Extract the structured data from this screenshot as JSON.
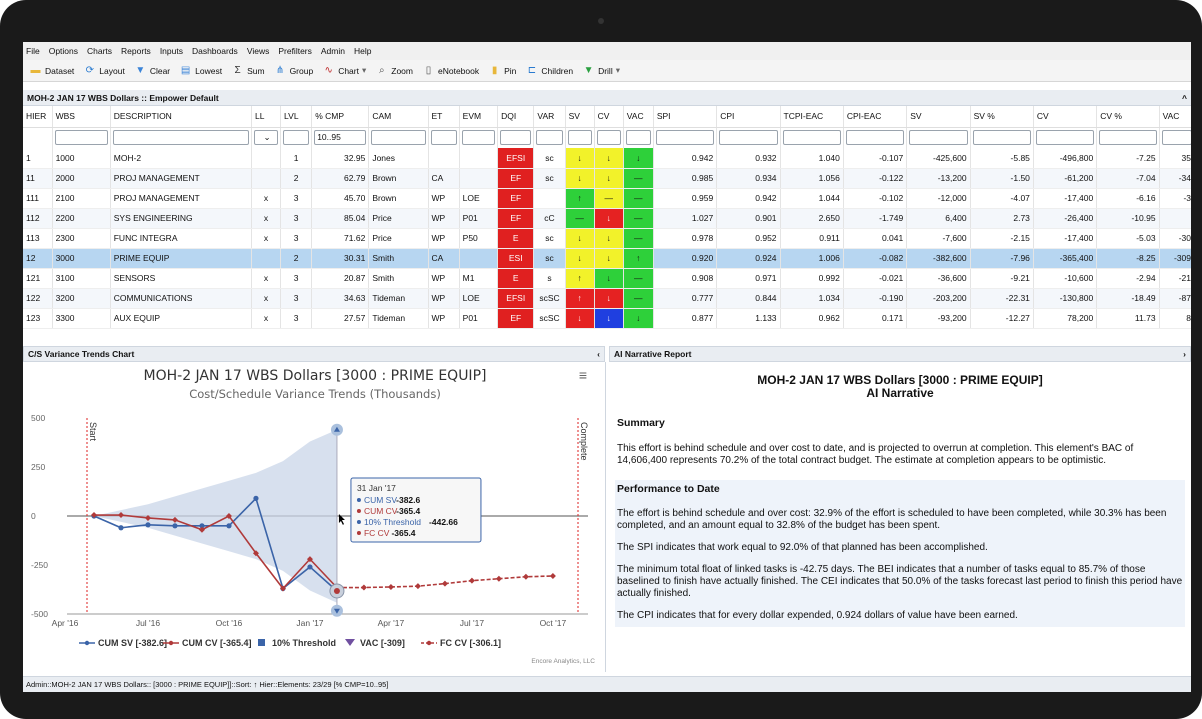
{
  "menu": [
    "File",
    "Options",
    "Charts",
    "Reports",
    "Inputs",
    "Dashboards",
    "Views",
    "Prefilters",
    "Admin",
    "Help"
  ],
  "toolbar": [
    {
      "label": "Dataset",
      "icon": "folder-icon",
      "glyph": "▬",
      "color": "#e8b73a"
    },
    {
      "label": "Layout",
      "icon": "refresh-icon",
      "glyph": "⟳",
      "color": "#2a7bd0"
    },
    {
      "label": "Clear",
      "icon": "clear-filter-icon",
      "glyph": "▼",
      "color": "#3b84d8"
    },
    {
      "label": "Lowest",
      "icon": "lowest-icon",
      "glyph": "▤",
      "color": "#3b84d8"
    },
    {
      "label": "Sum",
      "icon": "sigma-icon",
      "glyph": "Σ",
      "color": "#333333"
    },
    {
      "label": "Group",
      "icon": "group-icon",
      "glyph": "⋔",
      "color": "#2a7bd0"
    },
    {
      "label": "Chart",
      "icon": "chart-icon",
      "glyph": "∿",
      "color": "#c03030",
      "dropdown": "▾"
    },
    {
      "label": "Zoom",
      "icon": "zoom-icon",
      "glyph": "⌕",
      "color": "#555555"
    },
    {
      "label": "eNotebook",
      "icon": "notebook-icon",
      "glyph": "▯",
      "color": "#555555"
    },
    {
      "label": "Pin",
      "icon": "pin-icon",
      "glyph": "▮",
      "color": "#e8b73a"
    },
    {
      "label": "Children",
      "icon": "children-icon",
      "glyph": "⊏",
      "color": "#2a7bd0"
    },
    {
      "label": "Drill",
      "icon": "drill-icon",
      "glyph": "▼",
      "color": "#2aa040",
      "dropdown": "▾"
    }
  ],
  "grid": {
    "title": "MOH-2 JAN 17 WBS Dollars :: Empower Default",
    "collapse": "^",
    "columns": [
      "HIER",
      "WBS",
      "DESCRIPTION",
      "LL",
      "LVL",
      "% CMP",
      "CAM",
      "ET",
      "EVM",
      "DQI",
      "VAR",
      "SV",
      "CV",
      "VAC",
      "SPI",
      "CPI",
      "TCPI-EAC",
      "CPI-EAC",
      "SV",
      "SV %",
      "CV",
      "CV %",
      "VAC"
    ],
    "filter_cmp": "10..95",
    "ll_dropdown": "⌄",
    "rows": [
      {
        "hier": "1",
        "wbs": "1000",
        "desc": "MOH-2",
        "ll": "",
        "lvl": "1",
        "cmp": "32.95",
        "cam": "Jones",
        "et": "",
        "evm": "",
        "dqi": "EFSI",
        "var": "sc",
        "sv": "↓",
        "svc": "cy",
        "cv": "↓",
        "cvc": "cy",
        "vac": "↓",
        "vacc": "cg",
        "spi": "0.942",
        "cpi": "0.932",
        "tcpi": "1.040",
        "cpieac": "-0.107",
        "svd": "-425,600",
        "svp": "-5.85",
        "cvd": "-496,800",
        "cvp": "-7.25",
        "vacd": "35"
      },
      {
        "hier": "11",
        "wbs": "2000",
        "desc": "PROJ MANAGEMENT",
        "ll": "",
        "lvl": "2",
        "cmp": "62.79",
        "cam": "Brown",
        "et": "CA",
        "evm": "",
        "dqi": "EF",
        "var": "sc",
        "sv": "↓",
        "svc": "cy",
        "cv": "↓",
        "cvc": "cy",
        "vac": "—",
        "vacc": "cg",
        "spi": "0.985",
        "cpi": "0.934",
        "tcpi": "1.056",
        "cpieac": "-0.122",
        "svd": "-13,200",
        "svp": "-1.50",
        "cvd": "-61,200",
        "cvp": "-7.04",
        "vacd": "-34"
      },
      {
        "hier": "111",
        "wbs": "2100",
        "desc": "PROJ MANAGEMENT",
        "ll": "x",
        "lvl": "3",
        "cmp": "45.70",
        "cam": "Brown",
        "et": "WP",
        "evm": "LOE",
        "dqi": "EF",
        "var": "",
        "sv": "↑",
        "svc": "cg",
        "cv": "—",
        "cvc": "cy",
        "vac": "—",
        "vacc": "cg",
        "spi": "0.959",
        "cpi": "0.942",
        "tcpi": "1.044",
        "cpieac": "-0.102",
        "svd": "-12,000",
        "svp": "-4.07",
        "cvd": "-17,400",
        "cvp": "-6.16",
        "vacd": "-3"
      },
      {
        "hier": "112",
        "wbs": "2200",
        "desc": "SYS ENGINEERING",
        "ll": "x",
        "lvl": "3",
        "cmp": "85.04",
        "cam": "Price",
        "et": "WP",
        "evm": "P01",
        "dqi": "EF",
        "var": "cC",
        "sv": "—",
        "svc": "cg",
        "cv": "↓",
        "cvc": "cr",
        "vac": "—",
        "vacc": "cg",
        "spi": "1.027",
        "cpi": "0.901",
        "tcpi": "2.650",
        "cpieac": "-1.749",
        "svd": "6,400",
        "svp": "2.73",
        "cvd": "-26,400",
        "cvp": "-10.95",
        "vacd": ""
      },
      {
        "hier": "113",
        "wbs": "2300",
        "desc": "FUNC INTEGRA",
        "ll": "x",
        "lvl": "3",
        "cmp": "71.62",
        "cam": "Price",
        "et": "WP",
        "evm": "P50",
        "dqi": "E",
        "var": "sc",
        "sv": "↓",
        "svc": "cy",
        "cv": "↓",
        "cvc": "cy",
        "vac": "—",
        "vacc": "cg",
        "spi": "0.978",
        "cpi": "0.952",
        "tcpi": "0.911",
        "cpieac": "0.041",
        "svd": "-7,600",
        "svp": "-2.15",
        "cvd": "-17,400",
        "cvp": "-5.03",
        "vacd": "-30"
      },
      {
        "hier": "12",
        "wbs": "3000",
        "desc": "PRIME EQUIP",
        "ll": "",
        "lvl": "2",
        "cmp": "30.31",
        "cam": "Smith",
        "et": "CA",
        "evm": "",
        "dqi": "ESI",
        "var": "sc",
        "sv": "↓",
        "svc": "cy",
        "cv": "↓",
        "cvc": "cy",
        "vac": "↑",
        "vacc": "cg",
        "spi": "0.920",
        "cpi": "0.924",
        "tcpi": "1.006",
        "cpieac": "-0.082",
        "svd": "-382,600",
        "svp": "-7.96",
        "cvd": "-365,400",
        "cvp": "-8.25",
        "vacd": "-309",
        "sel": true
      },
      {
        "hier": "121",
        "wbs": "3100",
        "desc": "SENSORS",
        "ll": "x",
        "lvl": "3",
        "cmp": "20.87",
        "cam": "Smith",
        "et": "WP",
        "evm": "M1",
        "dqi": "E",
        "var": "s",
        "sv": "↑",
        "svc": "cy",
        "cv": "↓",
        "cvc": "cg",
        "vac": "—",
        "vacc": "cg",
        "spi": "0.908",
        "cpi": "0.971",
        "tcpi": "0.992",
        "cpieac": "-0.021",
        "svd": "-36,600",
        "svp": "-9.21",
        "cvd": "-10,600",
        "cvp": "-2.94",
        "vacd": "-21"
      },
      {
        "hier": "122",
        "wbs": "3200",
        "desc": "COMMUNICATIONS",
        "ll": "x",
        "lvl": "3",
        "cmp": "34.63",
        "cam": "Tideman",
        "et": "WP",
        "evm": "LOE",
        "dqi": "EFSI",
        "var": "scSC",
        "sv": "↑",
        "svc": "cr",
        "cv": "↓",
        "cvc": "cr",
        "vac": "—",
        "vacc": "cg",
        "spi": "0.777",
        "cpi": "0.844",
        "tcpi": "1.034",
        "cpieac": "-0.190",
        "svd": "-203,200",
        "svp": "-22.31",
        "cvd": "-130,800",
        "cvp": "-18.49",
        "vacd": "-87"
      },
      {
        "hier": "123",
        "wbs": "3300",
        "desc": "AUX EQUIP",
        "ll": "x",
        "lvl": "3",
        "cmp": "27.57",
        "cam": "Tideman",
        "et": "WP",
        "evm": "P01",
        "dqi": "EF",
        "var": "scSC",
        "sv": "↓",
        "svc": "cr",
        "cv": "↓",
        "cvc": "cb",
        "vac": "↓",
        "vacc": "cg",
        "spi": "0.877",
        "cpi": "1.133",
        "tcpi": "0.962",
        "cpieac": "0.171",
        "svd": "-93,200",
        "svp": "-12.27",
        "cvd": "78,200",
        "cvp": "11.73",
        "vacd": "8"
      }
    ]
  },
  "chart_panel": {
    "title": "C/S Variance Trends Chart",
    "collapse": "‹",
    "menu_icon": "≡"
  },
  "narr_panel": {
    "title": "AI Narrative Report",
    "expand": "›"
  },
  "chart_data": {
    "type": "line",
    "title": "MOH-2 JAN 17 WBS Dollars [3000 : PRIME EQUIP]",
    "subtitle": "Cost/Schedule Variance Trends (Thousands)",
    "x": [
      "May '16",
      "Jun '16",
      "Jul '16",
      "Aug '16",
      "Sep '16",
      "Oct '16",
      "Nov '16",
      "Dec '16",
      "Jan '17",
      "Feb '17",
      "Mar '17",
      "Apr '17",
      "May '17",
      "Jun '17",
      "Jul '17",
      "Aug '17",
      "Sep '17",
      "Oct '17"
    ],
    "xticks": [
      "Apr '16",
      "Jul '16",
      "Oct '16",
      "Jan '17",
      "Apr '17",
      "Jul '17",
      "Oct '17"
    ],
    "yticks": [
      500,
      250,
      0,
      -250,
      -500
    ],
    "ylim": [
      -500,
      500
    ],
    "series": [
      {
        "name": "CUM SV [-382.6]",
        "color": "#3b64a8",
        "values": [
          0,
          -60,
          -45,
          -50,
          -50,
          -50,
          90,
          -370,
          -260,
          -382.6
        ]
      },
      {
        "name": "CUM CV [-365.4]",
        "color": "#b03a3a",
        "values": [
          5,
          5,
          -10,
          -20,
          -70,
          0,
          -190,
          -370,
          -220,
          -365.4
        ]
      },
      {
        "name": "FC CV [-306.1]",
        "color": "#b03a3a",
        "dashed": true,
        "values": [
          null,
          null,
          null,
          null,
          null,
          null,
          null,
          null,
          null,
          -365.4,
          -365,
          -362,
          -358,
          -345,
          -330,
          -320,
          -310,
          -306.1
        ]
      }
    ],
    "threshold": {
      "name": "10% Threshold",
      "upper": [
        0,
        30,
        60,
        100,
        140,
        180,
        220,
        280,
        380,
        440
      ],
      "lower": [
        0,
        -30,
        -60,
        -100,
        -140,
        -180,
        -220,
        -280,
        -380,
        -442.66
      ]
    },
    "legend": [
      "CUM SV [-382.6]",
      "CUM CV [-365.4]",
      "10% Threshold",
      "VAC [-309]",
      "FC CV [-306.1]"
    ],
    "vlines": [
      {
        "label": "Start"
      },
      {
        "label": "Complete"
      }
    ],
    "tooltip": {
      "date": "31 Jan '17",
      "lines": [
        {
          "label": "CUM SV",
          "value": "-382.6",
          "color": "#3b64a8"
        },
        {
          "label": "CUM CV",
          "value": "-365.4",
          "color": "#b03a3a"
        },
        {
          "label": "10% Threshold",
          "value": "-442.66",
          "color": "#3b64a8"
        },
        {
          "label": "FC CV",
          "value": "-365.4",
          "color": "#b03a3a"
        }
      ]
    },
    "credit": "Encore Analytics, LLC"
  },
  "narrative": {
    "title": "MOH-2 JAN 17 WBS Dollars [3000 : PRIME EQUIP]",
    "subtitle": "AI Narrative",
    "summary_h": "Summary",
    "summary": "This effort is behind schedule and over cost to date, and is projected to overrun at completion. This element's BAC of 14,606,400 represents 70.2% of the total contract budget. The estimate at completion appears to be optimistic.",
    "perf_h": "Performance to Date",
    "p1": "The effort is behind schedule and over cost: 32.9% of the effort is scheduled to have been completed, while 30.3% has been completed, and an amount equal to 32.8% of the budget has been spent.",
    "p2": "The SPI indicates that work equal to 92.0% of that planned has been accomplished.",
    "p3": "The minimum total float of linked tasks is -42.75 days. The BEI indicates that a number of tasks equal to 85.7% of those baselined to finish have actually finished. The CEI indicates that 50.0% of the tasks forecast last period to finish this period have actually finished.",
    "p4": "The CPI indicates that for every dollar expended, 0.924 dollars of value have been earned."
  },
  "status": "Admin::MOH-2 JAN 17 WBS Dollars:: [3000 : PRIME EQUIP]]::Sort: ↑ Hier::Elements: 23/29 [% CMP=10..95]"
}
